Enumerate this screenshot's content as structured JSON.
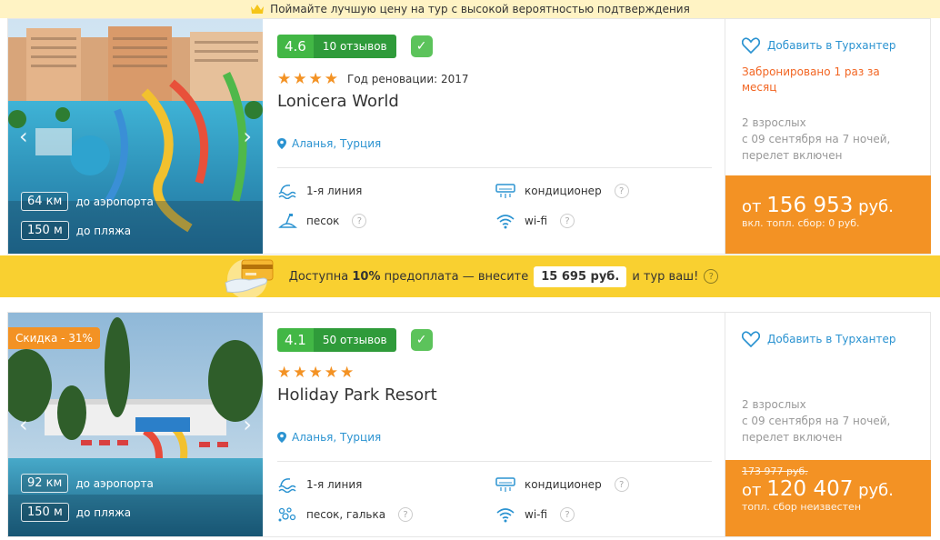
{
  "banner": {
    "text": "Поймайте лучшую цену на тур с высокой вероятностью подтверждения"
  },
  "prepay": {
    "text_before": "Доступна",
    "percent": "10%",
    "text_mid": "предоплата — внесите",
    "amount": "15 695 руб.",
    "text_after": "и тур ваш!"
  },
  "hotels": [
    {
      "discount": "",
      "rating": "4.6",
      "reviews": "10 отзывов",
      "stars": 4,
      "renovation": "Год реновации: 2017",
      "name": "Lonicera World",
      "location": "Аланья, Турция",
      "dist_airport": "64 км",
      "dist_airport_label": "до аэропорта",
      "dist_beach": "150 м",
      "dist_beach_label": "до пляжа",
      "features": [
        "1-я линия",
        "кондиционер",
        "песок",
        "wi-fi"
      ],
      "fav_label": "Добавить в Турхантер",
      "booked": "Забронировано 1 раз за месяц",
      "meta": [
        "2 взрослых",
        "с 09 сентября на 7 ночей,",
        "перелет включен"
      ],
      "price_old": "",
      "price_prefix": "от",
      "price": "156 953",
      "currency": "руб.",
      "fee": "вкл. топл. сбор: 0 руб."
    },
    {
      "discount": "Скидка - 31%",
      "rating": "4.1",
      "reviews": "50 отзывов",
      "stars": 5,
      "renovation": "",
      "name": "Holiday Park Resort",
      "location": "Аланья, Турция",
      "dist_airport": "92 км",
      "dist_airport_label": "до аэропорта",
      "dist_beach": "150 м",
      "dist_beach_label": "до пляжа",
      "features": [
        "1-я линия",
        "кондиционер",
        "песок, галька",
        "wi-fi"
      ],
      "fav_label": "Добавить в Турхантер",
      "booked": "",
      "meta": [
        "2 взрослых",
        "с 09 сентября на 7 ночей,",
        "перелет включен"
      ],
      "price_old": "173 977 руб.",
      "price_prefix": "от",
      "price": "120 407",
      "currency": "руб.",
      "fee": "топл. сбор неизвестен"
    }
  ],
  "colors": {
    "accent_orange": "#f39224",
    "rating_green": "#42b745",
    "link_blue": "#2b93d1",
    "prepay_yellow": "#f9d030"
  }
}
